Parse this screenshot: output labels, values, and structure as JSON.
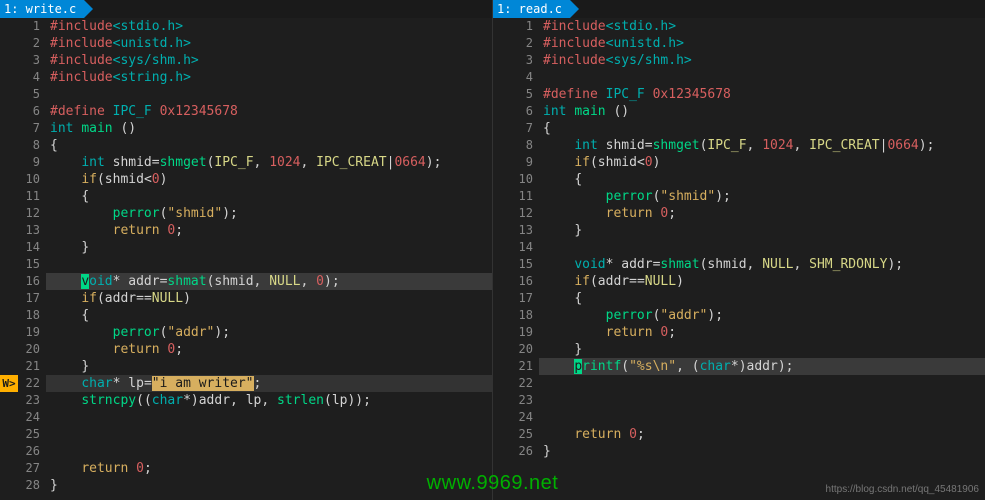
{
  "watermark": "www.9969.net",
  "footer_link": "https://blog.csdn.net/qq_45481906",
  "panes": [
    {
      "tab": "1: write.c",
      "gutter_mark_line": 22,
      "gutter_mark_text": "W>",
      "highlight_lines": [
        16,
        22
      ],
      "cursor": {
        "line": 16,
        "col": 0
      },
      "lines": [
        "#include<stdio.h>",
        "#include<unistd.h>",
        "#include<sys/shm.h>",
        "#include<string.h>",
        "",
        "#define IPC_F 0x12345678",
        "int main ()",
        "{",
        "    int shmid=shmget(IPC_F, 1024, IPC_CREAT|0664);",
        "    if(shmid<0)",
        "    {",
        "        perror(\"shmid\");",
        "        return 0;",
        "    }",
        "",
        "    void* addr=shmat(shmid, NULL, 0);",
        "    if(addr==NULL)",
        "    {",
        "        perror(\"addr\");",
        "        return 0;",
        "    }",
        "    char* lp=\"i am writer\";",
        "    strncpy((char*)addr, lp, strlen(lp));",
        "",
        "",
        "",
        "    return 0;",
        "}"
      ]
    },
    {
      "tab": "1: read.c",
      "gutter_mark_line": null,
      "gutter_mark_text": "",
      "highlight_lines": [
        21
      ],
      "cursor": {
        "line": 21,
        "col": 0
      },
      "lines": [
        "#include<stdio.h>",
        "#include<unistd.h>",
        "#include<sys/shm.h>",
        "",
        "#define IPC_F 0x12345678",
        "int main ()",
        "{",
        "    int shmid=shmget(IPC_F, 1024, IPC_CREAT|0664);",
        "    if(shmid<0)",
        "    {",
        "        perror(\"shmid\");",
        "        return 0;",
        "    }",
        "",
        "    void* addr=shmat(shmid, NULL, SHM_RDONLY);",
        "    if(addr==NULL)",
        "    {",
        "        perror(\"addr\");",
        "        return 0;",
        "    }",
        "    printf(\"%s\\n\", (char*)addr);",
        "",
        "",
        "",
        "    return 0;",
        "}"
      ]
    }
  ]
}
